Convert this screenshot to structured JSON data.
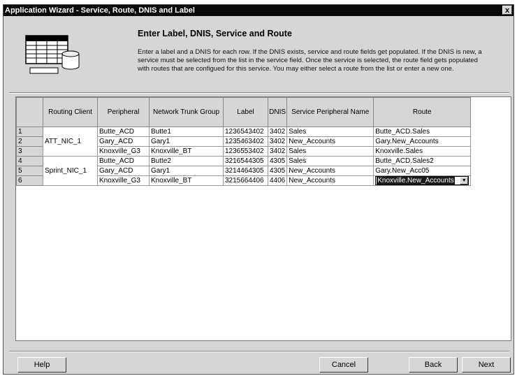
{
  "window": {
    "title": "Application Wizard - Service, Route, DNIS and Label",
    "close_glyph": "x"
  },
  "header": {
    "title": "Enter Label, DNIS, Service and Route",
    "description": "Enter a label and a DNIS for each row. If the DNIS  exists, service and route fields get populated. If the DNIS is new, a service must be selected  from the list in the service field. Once the service is selected, the route field gets populated with routes that are configued for this service. You may either select a route from the list or enter a new one."
  },
  "grid": {
    "columns": [
      "",
      "Routing Client",
      "Peripheral",
      "Network Trunk Group",
      "Label",
      "DNIS",
      "Service Peripheral Name",
      "Route"
    ],
    "routing_clients": [
      "ATT_NIC_1",
      "Sprint_NIC_1"
    ],
    "rows": [
      {
        "num": "1",
        "peripheral": "Butte_ACD",
        "trunk": "Butte1",
        "label": "1236543402",
        "dnis": "3402",
        "service": "Sales",
        "route": "Butte_ACD.Sales"
      },
      {
        "num": "2",
        "peripheral": "Gary_ACD",
        "trunk": "Gary1",
        "label": "1235463402",
        "dnis": "3402",
        "service": "New_Accounts",
        "route": "Gary.New_Accounts"
      },
      {
        "num": "3",
        "peripheral": "Knoxville_G3",
        "trunk": "Knoxville_BT",
        "label": "1236553402",
        "dnis": "3402",
        "service": "Sales",
        "route": "Knoxville.Sales"
      },
      {
        "num": "4",
        "peripheral": "Butte_ACD",
        "trunk": "Butte2",
        "label": "3216544305",
        "dnis": "4305",
        "service": "Sales",
        "route": "Butte_ACD.Sales2"
      },
      {
        "num": "5",
        "peripheral": "Gary_ACD",
        "trunk": "Gary1",
        "label": "3214464305",
        "dnis": "4305",
        "service": "New_Accounts",
        "route": "Gary.New_Acc05"
      },
      {
        "num": "6",
        "peripheral": "Knoxville_G3",
        "trunk": "Knoxville_BT",
        "label": "3215664406",
        "dnis": "4406",
        "service": "New_Accounts",
        "route": "Knoxville.New_Accounts"
      }
    ]
  },
  "buttons": {
    "help": "Help",
    "cancel": "Cancel",
    "back": "Back",
    "next": "Next"
  }
}
